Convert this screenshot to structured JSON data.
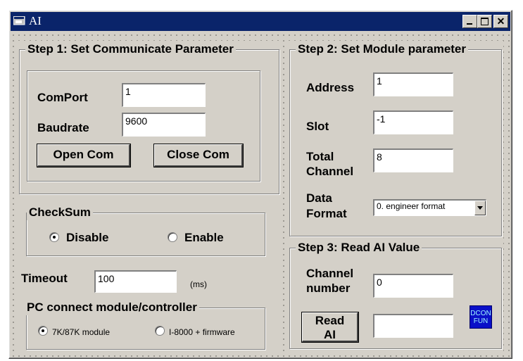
{
  "window": {
    "title": "AI"
  },
  "step1": {
    "legend": "Step 1: Set Communicate Parameter",
    "comport_label": "ComPort",
    "comport_value": "1",
    "baudrate_label": "Baudrate",
    "baudrate_value": "9600",
    "open_button": "Open Com",
    "close_button": "Close Com"
  },
  "checksum": {
    "legend": "CheckSum",
    "option_disable": "Disable",
    "option_enable": "Enable",
    "selected": "Disable"
  },
  "timeout": {
    "label": "Timeout",
    "value": "100",
    "unit": "(ms)"
  },
  "pc_connect": {
    "legend": "PC connect module/controller",
    "option_7k": "7K/87K module",
    "option_i8000": "I-8000 + firmware",
    "selected": "7K/87K module"
  },
  "step2": {
    "legend": "Step 2: Set Module parameter",
    "address_label": "Address",
    "address_value": "1",
    "slot_label": "Slot",
    "slot_value": "-1",
    "total_label_1": "Total",
    "total_label_2": "Channel",
    "total_value": "8",
    "format_label_1": "Data",
    "format_label_2": "Format",
    "format_value": "0. engineer format"
  },
  "step3": {
    "legend": "Step 3: Read AI Value",
    "channel_label_1": "Channel",
    "channel_label_2": "number",
    "channel_value": "0",
    "read_label_1": "Read",
    "read_label_2": "AI",
    "result_value": "",
    "logo_line_1": "DCON",
    "logo_line_2": "FUN"
  },
  "colors": {
    "titlebar": "#0a246a",
    "face": "#d4d0c8",
    "logo": "#0a10c8"
  },
  "icons": [
    "app-icon",
    "minimize-icon",
    "maximize-icon",
    "close-icon",
    "dcon-fun-logo"
  ]
}
